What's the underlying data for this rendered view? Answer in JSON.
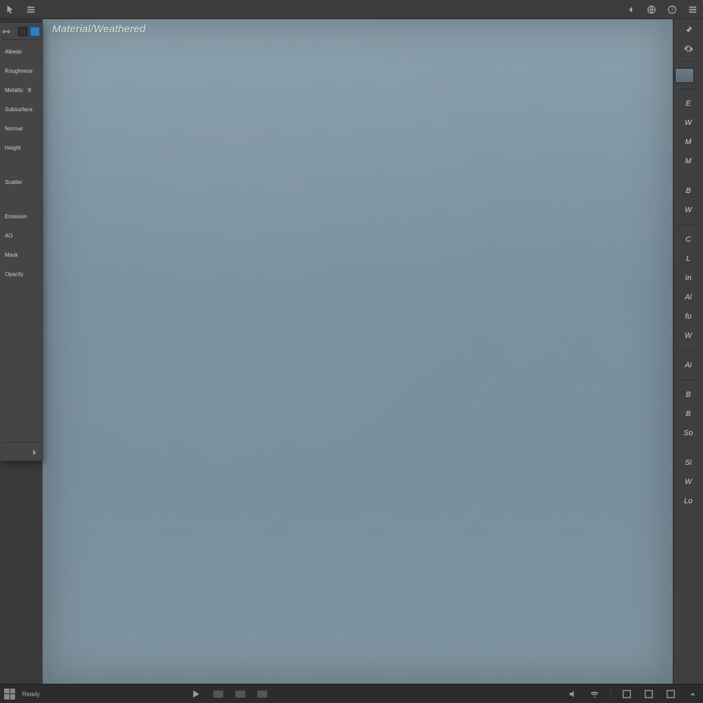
{
  "topbar": {
    "left_icons": [
      "pointer-icon",
      "menu-icon"
    ],
    "right_icons": [
      "back-icon",
      "globe-icon",
      "help-icon",
      "menu-icon"
    ]
  },
  "canvas": {
    "title": "Material/Weathered"
  },
  "left_panel": {
    "tab_active": true,
    "items": [
      {
        "label": "Albedo"
      },
      {
        "label": "Roughness"
      },
      {
        "label": "Metallic",
        "pin": true
      },
      {
        "label": "Subsurface"
      },
      {
        "label": "Normal"
      },
      {
        "label": "Height"
      },
      {
        "label": "Scatter"
      },
      {
        "label": "Emission"
      },
      {
        "label": "AO"
      },
      {
        "label": "Mask"
      },
      {
        "label": "Opacity"
      }
    ]
  },
  "right_sidebar": {
    "head_icons": [
      "pin-icon",
      "gear-icon"
    ],
    "items": [
      "E",
      "W",
      "M",
      "M",
      "B",
      "W",
      "C",
      "L",
      "In",
      "Al",
      "fu",
      "W",
      "Ai",
      "B",
      "B",
      "So",
      "Si",
      "W",
      "Lo"
    ]
  },
  "taskbar": {
    "status": "Ready",
    "center_icons": [
      "play-icon",
      "app-icon",
      "app-icon",
      "app-icon"
    ],
    "right_icons": [
      "volume-icon",
      "wifi-icon",
      "square-icon",
      "square-icon",
      "square-icon",
      "chevron-icon"
    ]
  }
}
